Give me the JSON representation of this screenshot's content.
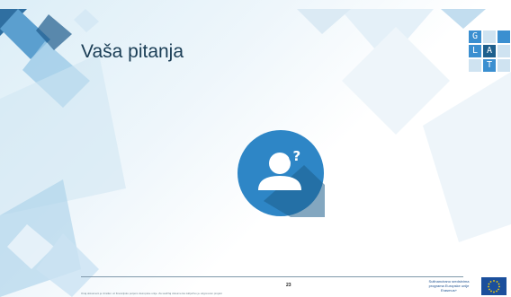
{
  "slide": {
    "title": "Vaša pitanja",
    "page_number": "23",
    "footer_text": "Ovaj dokument je izrađen uz financijsku potporu Europske unije. Za sadržaj dokumenta isključivo je odgovoran projekt",
    "eu_cofinance_lines": [
      "Sufinancirano sredstvima",
      "programa Europske unije",
      "Erasmus+"
    ]
  },
  "logo": {
    "letters": [
      "G",
      "L",
      "A",
      "T"
    ]
  },
  "icons": {
    "center": "user-question-icon",
    "flag": "eu-flag-icon"
  },
  "colors": {
    "accent": "#2e86c6",
    "accent_dark": "#1d5f8d",
    "title": "#1a3d55",
    "panel_light": "#9ecbe6"
  }
}
